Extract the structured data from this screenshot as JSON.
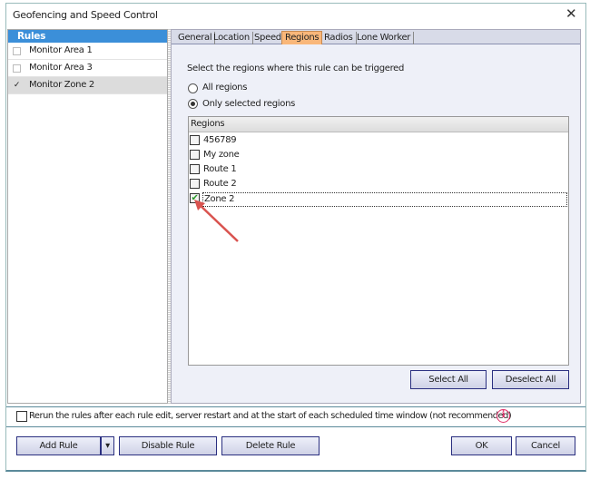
{
  "window": {
    "title": "Geofencing and Speed Control",
    "close": "✕"
  },
  "rules": {
    "header": "Rules",
    "items": [
      {
        "label": "Monitor Area 1",
        "checked": false
      },
      {
        "label": "Monitor Area 3",
        "checked": false
      },
      {
        "label": "Monitor Zone 2",
        "checked": true,
        "mark": "✓"
      }
    ]
  },
  "tabs": [
    {
      "label": "General"
    },
    {
      "label": "Location"
    },
    {
      "label": "Speed"
    },
    {
      "label": "Regions",
      "active": true
    },
    {
      "label": "Radios"
    },
    {
      "label": "Lone Worker"
    }
  ],
  "regions_tab": {
    "instruction": "Select the regions where this rule can be triggered",
    "radio_all": "All regions",
    "radio_selected": "Only selected regions",
    "list_header": "Regions",
    "items": [
      {
        "label": "456789"
      },
      {
        "label": "My zone"
      },
      {
        "label": "Route 1"
      },
      {
        "label": "Route 2"
      },
      {
        "label": "Zone 2",
        "checked": true,
        "mark": "✔"
      }
    ],
    "select_all": "Select All",
    "deselect_all": "Deselect All"
  },
  "rerun_label": "Rerun the rules after each rule edit, server restart and at the start of each scheduled time window (not recommended)",
  "info_icon": "i",
  "buttons": {
    "add_rule": "Add Rule",
    "dropdown": "▾",
    "disable_rule": "Disable Rule",
    "delete_rule": "Delete Rule",
    "ok": "OK",
    "cancel": "Cancel"
  }
}
